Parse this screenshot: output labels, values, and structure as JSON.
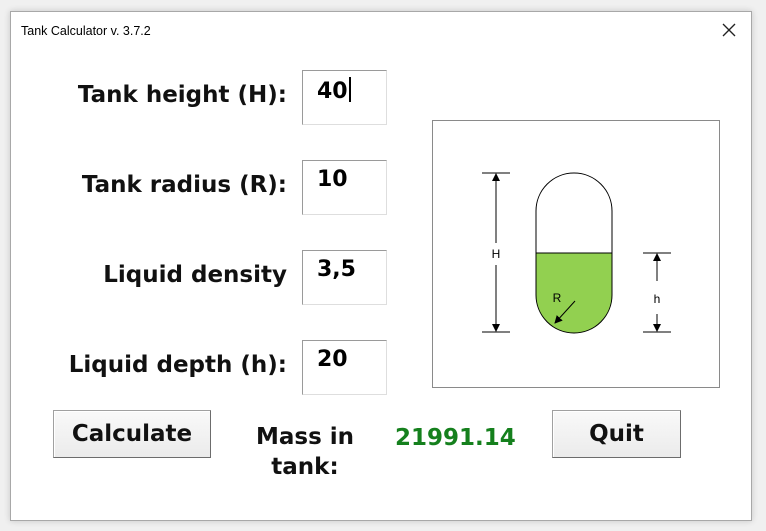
{
  "window": {
    "title": "Tank Calculator v. 3.7.2"
  },
  "form": {
    "height": {
      "label": "Tank height (H):",
      "value": "40"
    },
    "radius": {
      "label": "Tank radius (R):",
      "value": "10"
    },
    "density": {
      "label": "Liquid density",
      "value": "3,5"
    },
    "depth": {
      "label": "Liquid depth (h):",
      "value": "20"
    }
  },
  "actions": {
    "calculate_label": "Calculate",
    "quit_label": "Quit"
  },
  "result": {
    "label_line1": "Mass in",
    "label_line2": "tank:",
    "value": "21991.14"
  },
  "diagram": {
    "label_H": "H",
    "label_R": "R",
    "label_h": "h"
  },
  "colors": {
    "liquid": "#92d050",
    "result_text": "#15801d"
  },
  "icons": {
    "close": "close-icon"
  }
}
